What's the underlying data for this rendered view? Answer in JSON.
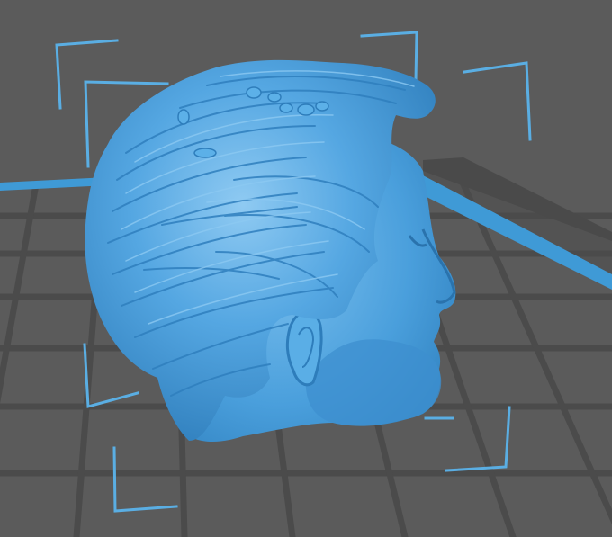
{
  "viewport": {
    "background": "#5b5b5b",
    "grid_color": "#4c4c4c",
    "bed_edge_color": "#3f9ad6",
    "selection_bracket_color": "#5aaee3",
    "model_color": "#4ea3e0",
    "model_shadow_color": "#2f7fbe",
    "model_highlight_color": "#8cc9f2",
    "model_icon": "head-bust-model-icon",
    "selection_icon": "selection-bounding-box-icon"
  }
}
